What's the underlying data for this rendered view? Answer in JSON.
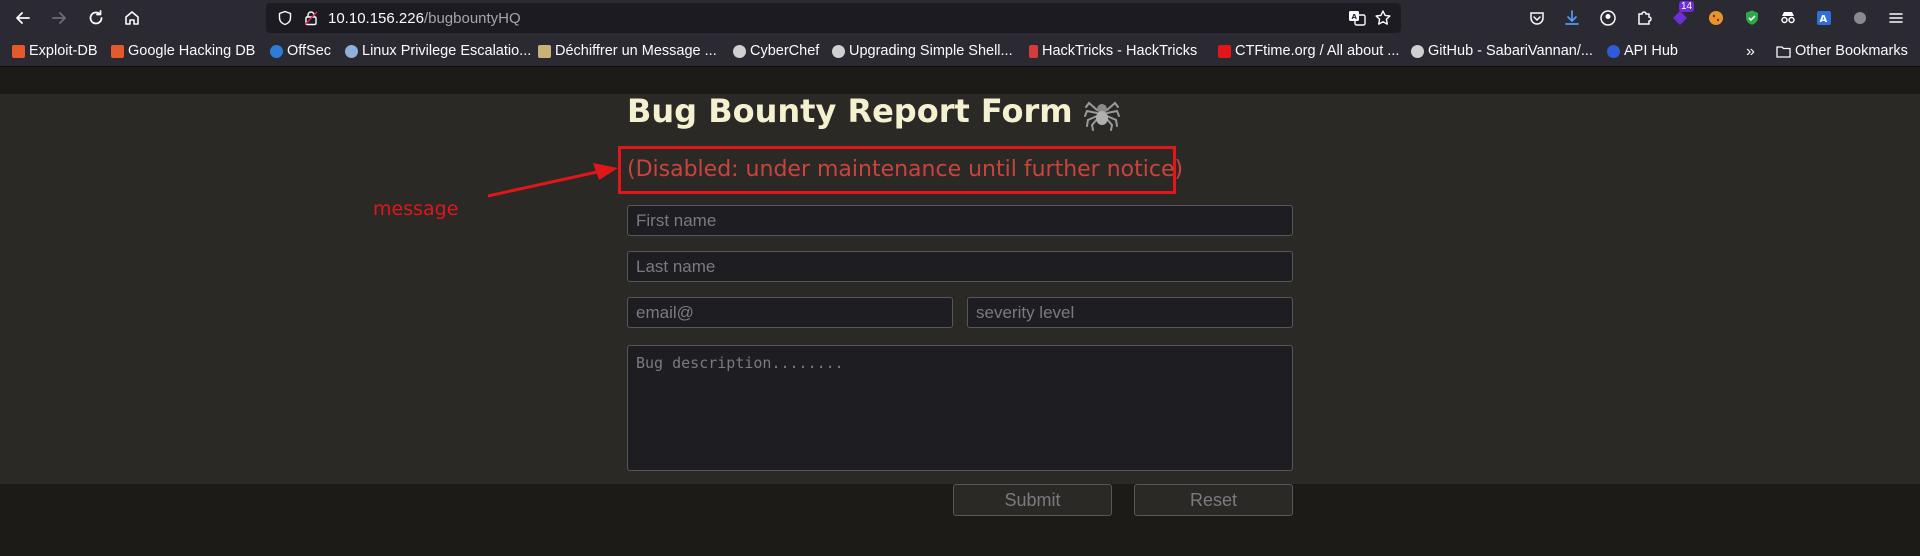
{
  "browser": {
    "url_host": "10.10.156.226",
    "url_path": "/bugbountyHQ",
    "downloads_badge": "14",
    "icons": [
      "back-icon",
      "forward-icon",
      "reload-icon",
      "home-icon",
      "shield-icon",
      "lock-icon",
      "translate-icon",
      "star-icon",
      "pocket-icon",
      "download-icon",
      "account-icon",
      "extensions-icon",
      "menu-icon"
    ]
  },
  "bookmarks": [
    {
      "label": "Exploit-DB",
      "color": "#e45a2c"
    },
    {
      "label": "Google Hacking DB",
      "color": "#e45a2c"
    },
    {
      "label": "OffSec",
      "color": "#2f7bd8"
    },
    {
      "label": "Linux Privilege Escalatio...",
      "color": "#8fb0d8"
    },
    {
      "label": "Déchiffrer un Message ...",
      "color": "#c9b17a"
    },
    {
      "label": "CyberChef",
      "color": "#d0d0d0"
    },
    {
      "label": "Upgrading Simple Shell...",
      "color": "#d0d0d0"
    },
    {
      "label": "HackTricks - HackTricks",
      "color": "#d63a3a"
    },
    {
      "label": "CTFtime.org / All about ...",
      "color": "#e0161a"
    },
    {
      "label": "GitHub - SabariVannan/...",
      "color": "#d0d0d0"
    },
    {
      "label": "API Hub",
      "color": "#2f5bd8"
    }
  ],
  "bookmarks_other": "Other Bookmarks",
  "page": {
    "title": "Bug Bounty Report Form",
    "notice": "(Disabled: under maintenance until further notice)",
    "annotation": "message",
    "form": {
      "first_name_placeholder": "First name",
      "last_name_placeholder": "Last name",
      "email_placeholder": "email@",
      "severity_placeholder": "severity level",
      "description_placeholder": "Bug description........",
      "submit_label": "Submit",
      "reset_label": "Reset"
    }
  },
  "colors": {
    "accent_red": "#e0161a",
    "notice_text": "#c9443c",
    "title_text": "#f4f1d0"
  }
}
